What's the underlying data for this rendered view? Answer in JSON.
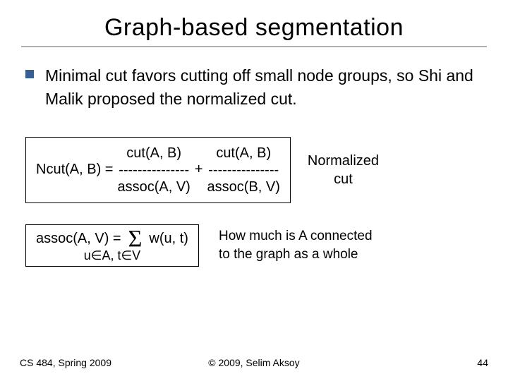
{
  "title": "Graph-based segmentation",
  "bullet": "Minimal cut favors cutting off small node groups, so Shi and Malik proposed the normalized cut.",
  "ncut": {
    "lhs": "Ncut(A, B) =",
    "num1": "cut(A, B)",
    "dash": "---------------",
    "den1": "assoc(A, V)",
    "plus": "+",
    "num2": "cut(A, B)",
    "den2": "assoc(B, V)",
    "label_l1": "Normalized",
    "label_l2": "cut"
  },
  "assoc": {
    "lhs": "assoc(A, V) =",
    "sigma": "Σ",
    "weight": "w(u, t)",
    "range": "u∈A, t∈V",
    "desc_l1": "How much is A connected",
    "desc_l2": "to the graph as a whole"
  },
  "footer": {
    "left": "CS 484, Spring 2009",
    "center": "© 2009, Selim Aksoy",
    "right": "44"
  }
}
